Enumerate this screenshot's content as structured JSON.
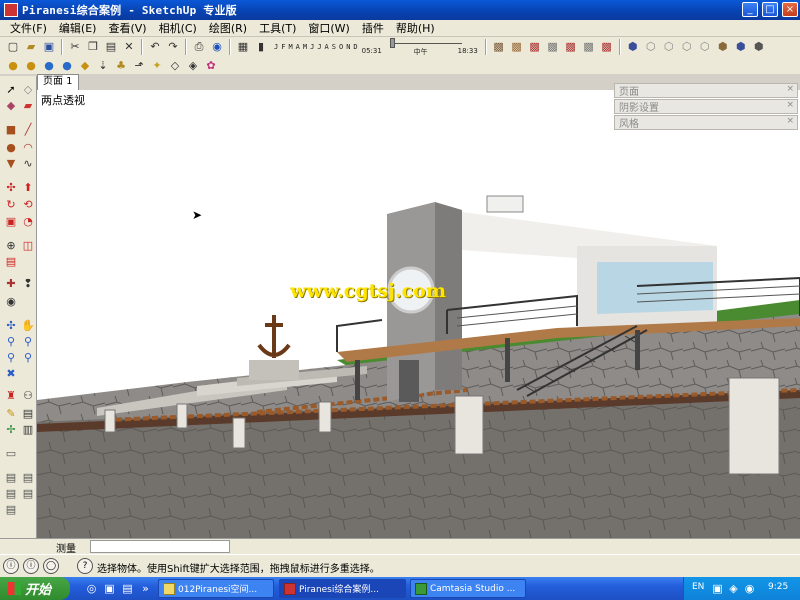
{
  "window": {
    "title": "Piranesi综合案例 - SketchUp 专业版",
    "controls": {
      "minimize": "_",
      "maximize": "□",
      "close": "×"
    }
  },
  "menu": [
    "文件(F)",
    "编辑(E)",
    "查看(V)",
    "相机(C)",
    "绘图(R)",
    "工具(T)",
    "窗口(W)",
    "插件",
    "帮助(H)"
  ],
  "shadow_toolbar": {
    "months": [
      "J",
      "F",
      "M",
      "A",
      "M",
      "J",
      "J",
      "A",
      "S",
      "O",
      "N",
      "D"
    ],
    "time_start": "05:31",
    "time_noon": "中午",
    "time_end": "18:33"
  },
  "scene_tab": "页面 1",
  "viewport": {
    "view_label": "两点透视",
    "watermark": "www.cgtsj.com",
    "colors": {
      "sky": "#ffffff",
      "pavement": "#6e6a66",
      "slope": "#8a8784",
      "grass": "#4a8a30",
      "wall": "#9a9896",
      "timber": "#b07a48"
    }
  },
  "tray_panels": [
    {
      "label": "页面",
      "close": "×"
    },
    {
      "label": "阴影设置",
      "close": "×"
    },
    {
      "label": "风格",
      "close": "×"
    }
  ],
  "measurements": {
    "label": "测量"
  },
  "status": {
    "text": "选择物体。使用Shift键扩大选择范围，拖拽鼠标进行多重选择。"
  },
  "taskbar": {
    "start_label": "开始",
    "tasks": [
      {
        "label": "012Piranesi空间...",
        "active": false
      },
      {
        "label": "Piranesi综合案例...",
        "active": true
      },
      {
        "label": "Camtasia Studio ...",
        "active": false
      }
    ],
    "language": "EN",
    "clock": "9:25"
  },
  "icons": {
    "top_toolbar": [
      "new-icon",
      "open-icon",
      "save-icon",
      "cut-icon",
      "copy-icon",
      "paste-icon",
      "erase-icon",
      "undo-icon",
      "redo-icon",
      "print-icon",
      "model-info-icon",
      "shadow-toggle-icon",
      "fog-icon"
    ],
    "views": [
      "iso-view-icon",
      "top-view-icon",
      "front-view-icon",
      "right-view-icon",
      "back-view-icon",
      "left-view-icon",
      "xray-icon",
      "wireframe-icon",
      "hidden-line-icon",
      "shaded-icon",
      "textured-icon",
      "monochrome-icon"
    ],
    "left_tools": [
      "select-icon",
      "make-component-icon",
      "paint-icon",
      "eraser-icon",
      "rectangle-icon",
      "line-icon",
      "circle-icon",
      "arc-icon",
      "polygon-icon",
      "freehand-icon",
      "move-icon",
      "push-pull-icon",
      "rotate-icon",
      "follow-me-icon",
      "scale-icon",
      "offset-icon",
      "tape-icon",
      "dimension-icon",
      "protractor-icon",
      "text-icon",
      "axes-icon",
      "3d-text-icon",
      "orbit-icon",
      "pan-icon",
      "zoom-icon",
      "zoom-window-icon",
      "zoom-extents-icon",
      "previous-view-icon",
      "position-camera-icon",
      "walk-icon",
      "look-around-icon",
      "section-plane-icon"
    ]
  }
}
